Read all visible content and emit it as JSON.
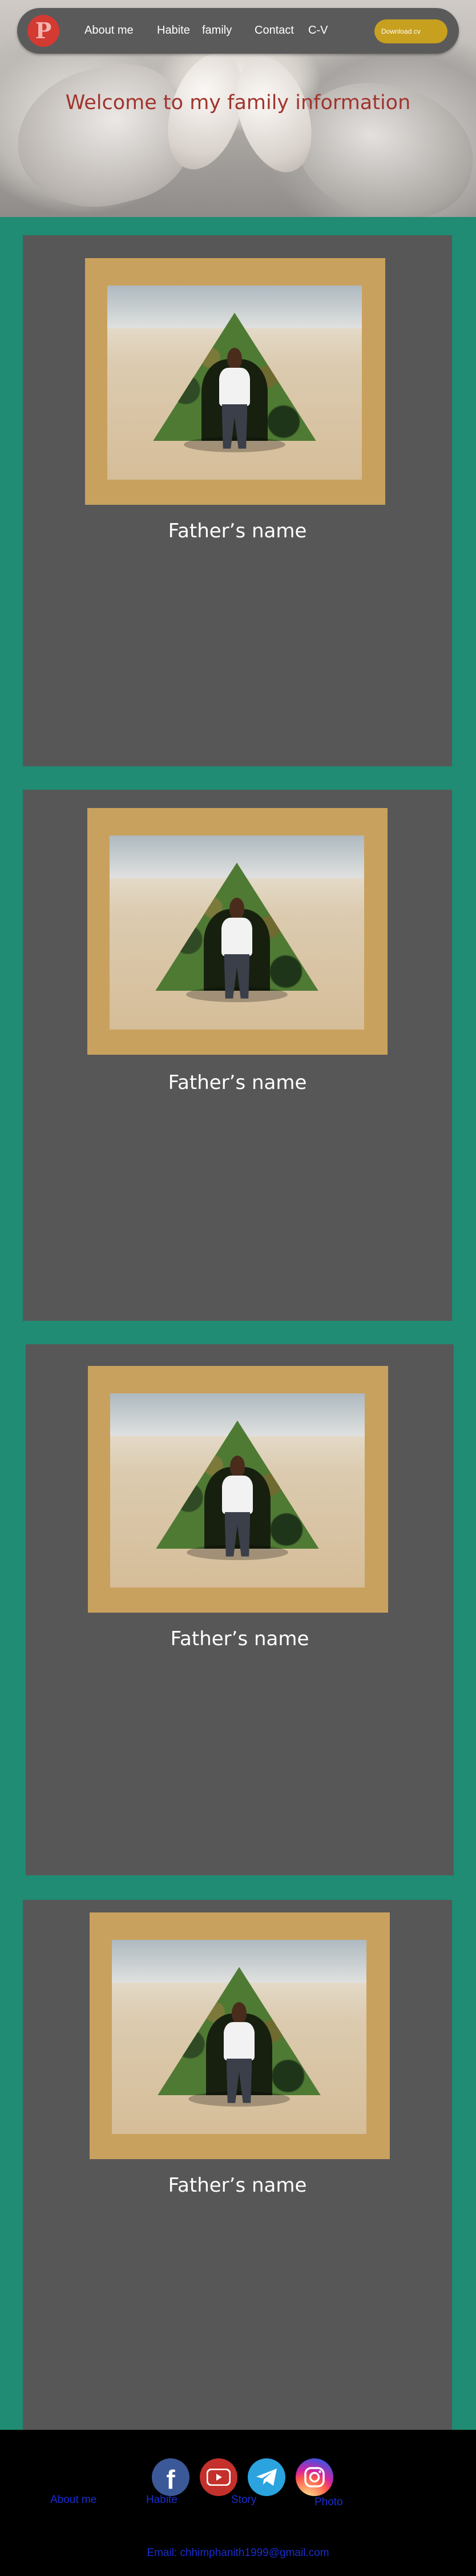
{
  "hero": {
    "title": "Welcome to my family information"
  },
  "nav": {
    "logo_icon": "pinterest-icon",
    "items": [
      "About me",
      "Habite",
      "family",
      "Contact",
      "C-V"
    ],
    "download_label": "Download cv"
  },
  "cards": [
    {
      "caption": "Father’s name",
      "photo": "man sitting in front of camouflage tent on beach"
    },
    {
      "caption": "Father’s name",
      "photo": "man sitting in front of camouflage tent on beach"
    },
    {
      "caption": "Father’s name",
      "photo": "man sitting in front of camouflage tent on beach"
    },
    {
      "caption": "Father’s name",
      "photo": "man sitting in front of camouflage tent on beach"
    }
  ],
  "footer": {
    "social_icons": [
      "facebook-icon",
      "youtube-icon",
      "telegram-icon",
      "instagram-icon"
    ],
    "links": [
      "About me",
      "Habite",
      "Story",
      "Photo"
    ],
    "email": "Email: chhimphanith1999@gmail.com"
  },
  "colors": {
    "background": "#1f8c73",
    "card": "#575757",
    "frame": "#c9a15e",
    "nav": "#5a5a5a",
    "logo": "#d23a32",
    "download_button": "#c8a020",
    "hero_title": "#a0342d",
    "footer": "#000000",
    "footer_link": "#1a2ecf"
  }
}
